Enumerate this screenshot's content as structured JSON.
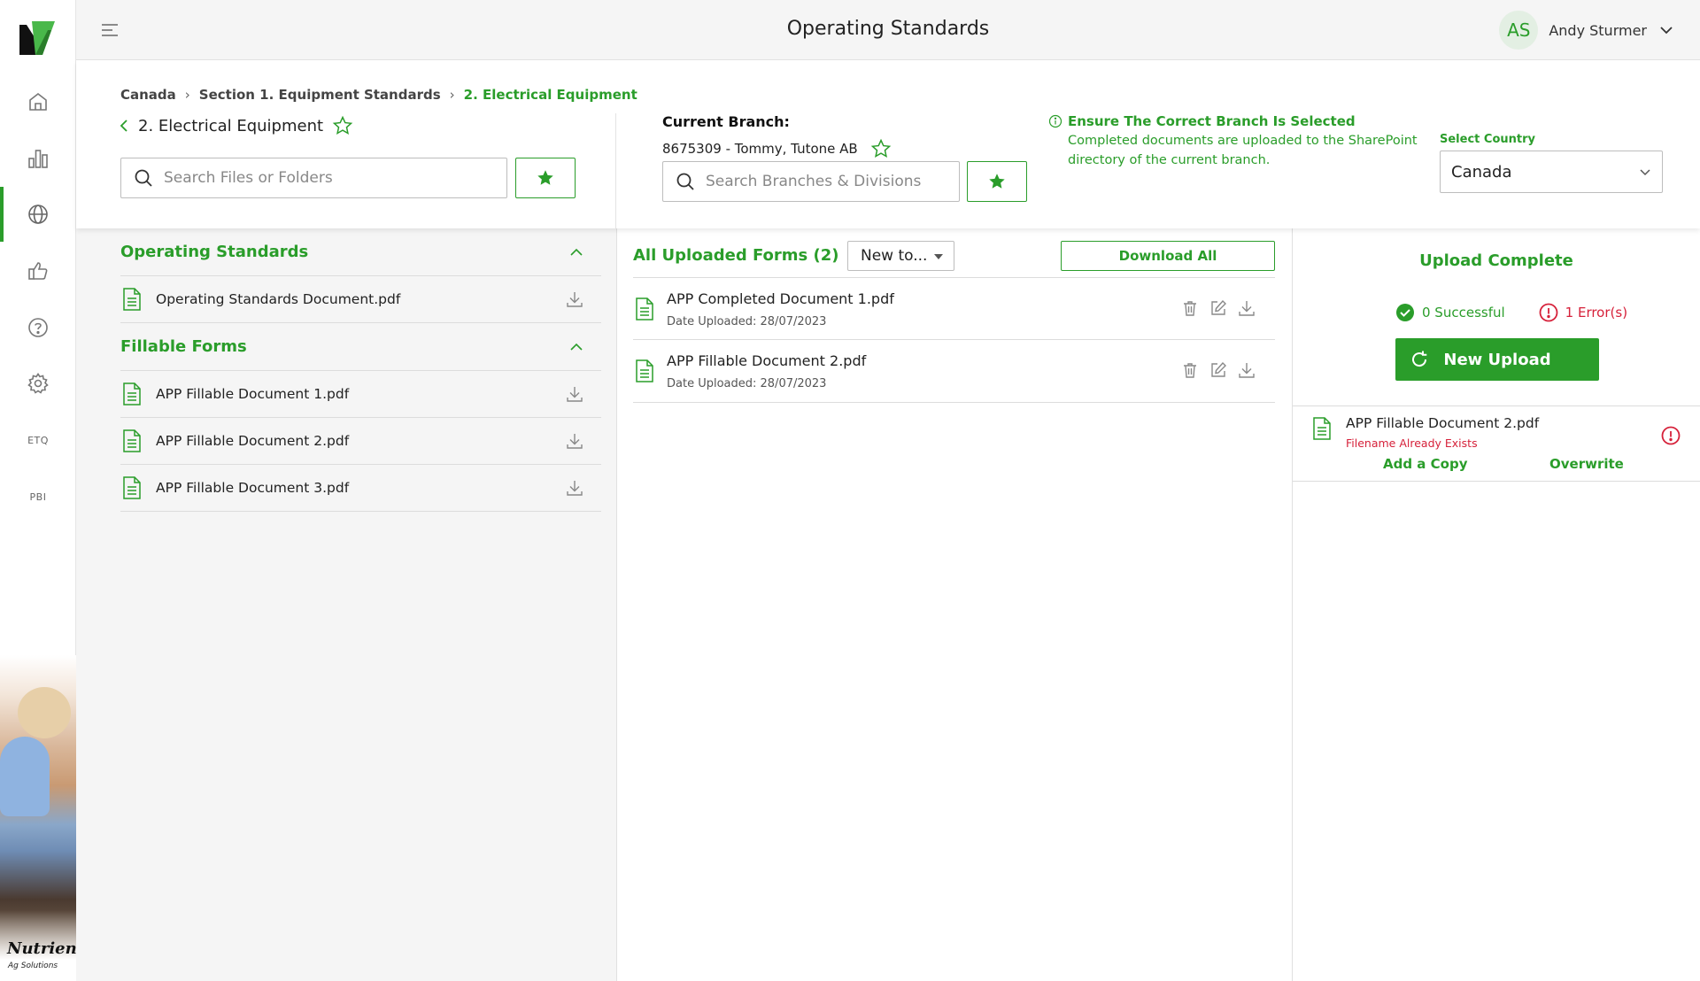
{
  "app": {
    "title": "Operating Standards",
    "brand_name": "Nutrien",
    "brand_sub": "Ag Solutions"
  },
  "user": {
    "initials": "AS",
    "name": "Andy Sturmer"
  },
  "sidebar": {
    "items": [
      {
        "name": "home",
        "icon": "home-icon"
      },
      {
        "name": "reports",
        "icon": "bar-chart-icon"
      },
      {
        "name": "global",
        "icon": "globe-icon",
        "active": true
      },
      {
        "name": "feedback",
        "icon": "thumbs-up-icon"
      },
      {
        "name": "help",
        "icon": "help-circle-icon"
      },
      {
        "name": "settings",
        "icon": "gear-icon"
      },
      {
        "name": "etq",
        "label": "ETQ"
      },
      {
        "name": "pbi",
        "label": "PBI"
      }
    ]
  },
  "breadcrumb": [
    "Canada",
    "Section 1. Equipment Standards",
    "2. Electrical Equipment"
  ],
  "folder": {
    "title": "2. Electrical Equipment",
    "search_placeholder": "Search Files or Folders"
  },
  "branch": {
    "label": "Current Branch:",
    "value": "8675309 - Tommy, Tutone AB",
    "search_placeholder": "Search Branches & Divisions"
  },
  "notice": {
    "title": "Ensure The Correct Branch Is Selected",
    "body": "Completed documents are uploaded to the SharePoint directory of the current branch."
  },
  "country": {
    "label": "Select Country",
    "value": "Canada"
  },
  "left": {
    "sections": [
      {
        "title": "Operating Standards",
        "files": [
          "Operating Standards Document.pdf"
        ]
      },
      {
        "title": "Fillable Forms",
        "files": [
          "APP Fillable Document 1.pdf",
          "APP Fillable Document 2.pdf",
          "APP Fillable Document 3.pdf"
        ]
      }
    ]
  },
  "uploaded": {
    "title": "All Uploaded Forms (2)",
    "sort_value": "New to...",
    "download_all_label": "Download All",
    "items": [
      {
        "name": "APP Completed Document 1.pdf",
        "date": "Date Uploaded: 28/07/2023"
      },
      {
        "name": "APP Fillable Document 2.pdf",
        "date": "Date Uploaded: 28/07/2023"
      }
    ]
  },
  "upload_status": {
    "title": "Upload Complete",
    "successful": "0 Successful",
    "errors": "1 Error(s)",
    "new_upload_label": "New Upload",
    "error_item": {
      "file": "APP Fillable Document 2.pdf",
      "message": "Filename Already Exists",
      "add_copy_label": "Add a Copy",
      "overwrite_label": "Overwrite"
    }
  },
  "colors": {
    "accent": "#2a9d2a",
    "error": "#d6213a",
    "panel_bg": "#f5f5f5"
  }
}
